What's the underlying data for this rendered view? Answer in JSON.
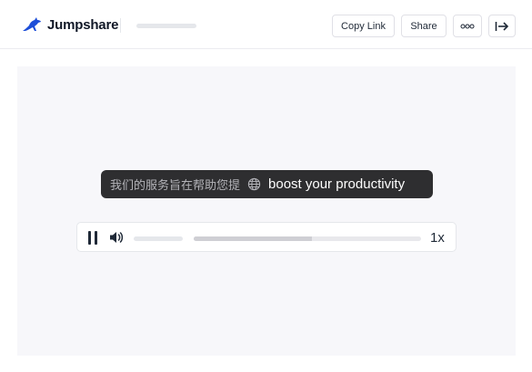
{
  "header": {
    "logo_text": "Jumpshare",
    "logo_icon": "kangaroo-icon",
    "copy_link_label": "Copy Link",
    "share_label": "Share",
    "more_icon": "more-dots-icon",
    "exit_icon": "exit-arrow-icon"
  },
  "caption": {
    "source_text": "我们的服务旨在帮助您提",
    "globe_icon": "globe-icon",
    "translated_text": "boost your productivity"
  },
  "player": {
    "pause_icon": "pause-icon",
    "volume_icon": "volume-icon",
    "progress_fraction": 0.52,
    "speed_label": "1x"
  },
  "colors": {
    "brand": "#1d4ed8",
    "caption_bg": "#2e2e30",
    "stage_bg": "#f7f7fa"
  }
}
